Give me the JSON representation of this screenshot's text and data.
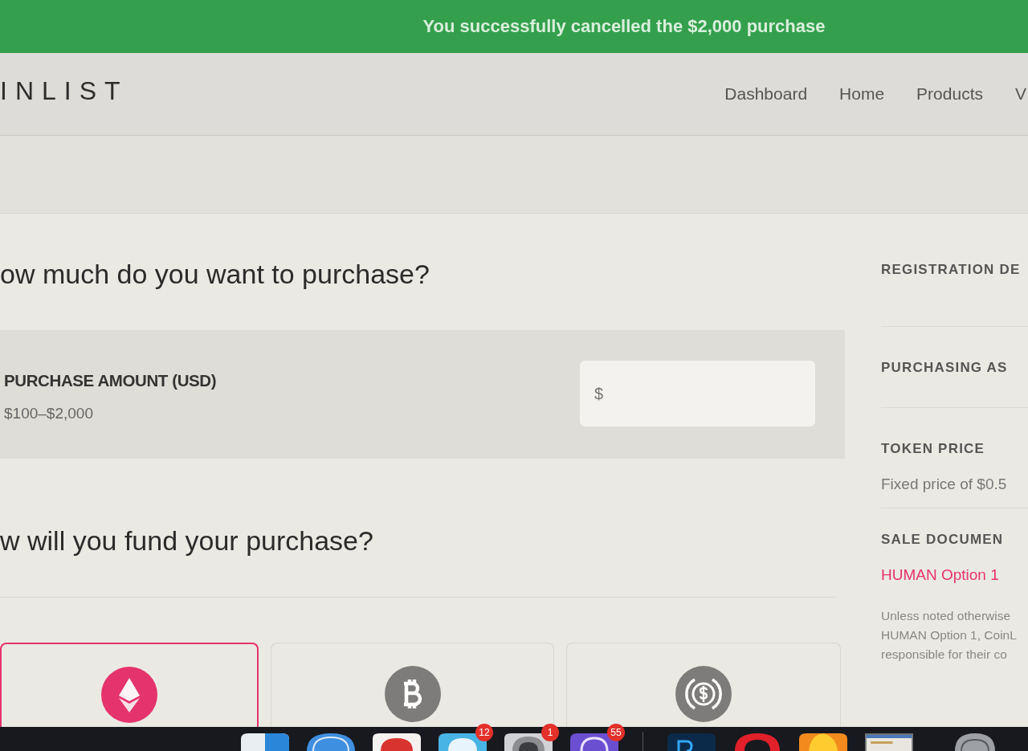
{
  "notification_banner": {
    "message": "You successfully cancelled the $2,000 purchase"
  },
  "header": {
    "logo": "INLIST",
    "nav": [
      "Dashboard",
      "Home",
      "Products",
      "V"
    ]
  },
  "purchase_amount": {
    "heading": "ow much do you want to purchase?",
    "label": "PURCHASE AMOUNT (USD)",
    "range": "$100–$2,000",
    "field": {
      "prefix": "$"
    }
  },
  "funding": {
    "heading": "w will you fund your purchase?",
    "methods": [
      {
        "kind": "ethereum",
        "selected": true
      },
      {
        "kind": "bitcoin",
        "selected": false
      },
      {
        "kind": "usdc",
        "selected": false
      }
    ]
  },
  "sidebar": {
    "groups": [
      {
        "title": "REGISTRATION DE"
      },
      {
        "title": "PURCHASING AS"
      },
      {
        "title": "TOKEN PRICE",
        "value": "Fixed price of $0.5"
      },
      {
        "title": "SALE DOCUMEN",
        "link": "HUMAN Option 1",
        "note": [
          "Unless noted otherwise",
          "HUMAN Option 1, CoinL",
          "responsible for their co"
        ]
      }
    ]
  },
  "dock": {
    "apps": [
      {
        "kind": "tile"
      },
      {
        "kind": "compass"
      },
      {
        "kind": "disc"
      },
      {
        "kind": "bubble",
        "badge": "12"
      },
      {
        "kind": "gear",
        "badge": "1"
      },
      {
        "kind": "chat",
        "badge": "55"
      },
      {
        "kind": "separator"
      },
      {
        "kind": "ps"
      },
      {
        "kind": "ring"
      },
      {
        "kind": "flame"
      },
      {
        "kind": "window"
      },
      {
        "kind": "trash"
      }
    ]
  }
}
